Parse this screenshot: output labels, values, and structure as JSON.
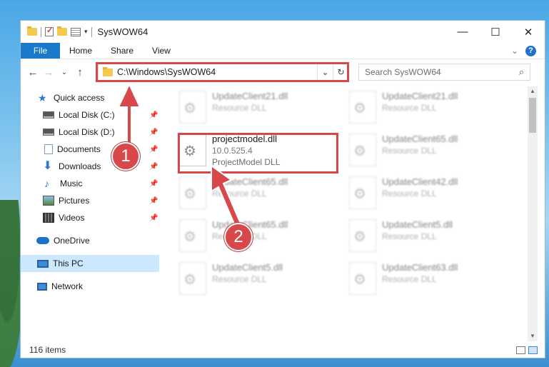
{
  "window": {
    "title": "SysWOW64",
    "quick_access_toolbar": [
      "folder-icon",
      "checkmark-icon",
      "new-folder-icon",
      "properties-icon"
    ],
    "controls": {
      "minimize": "—",
      "maximize": "☐",
      "close": "✕"
    }
  },
  "ribbon": {
    "tabs": [
      {
        "label": "File",
        "active": true
      },
      {
        "label": "Home"
      },
      {
        "label": "Share"
      },
      {
        "label": "View"
      }
    ],
    "collapse": "⌄",
    "help": "?"
  },
  "navigation": {
    "back": "←",
    "forward": "→",
    "recent": "⌄",
    "up": "↑"
  },
  "address": {
    "path": "C:\\Windows\\SysWOW64",
    "dropdown": "⌄",
    "refresh": "↻"
  },
  "search": {
    "placeholder": "Search SysWOW64",
    "icon": "search-icon"
  },
  "sidebar": {
    "items": [
      {
        "label": "Quick access",
        "icon": "star-icon"
      },
      {
        "label": "Local Disk (C:)",
        "icon": "disk-icon",
        "pinned": true
      },
      {
        "label": "Local Disk (D:)",
        "icon": "disk-icon",
        "pinned": true
      },
      {
        "label": "Documents",
        "icon": "documents-icon",
        "pinned": true
      },
      {
        "label": "Downloads",
        "icon": "download-icon",
        "pinned": true
      },
      {
        "label": "Music",
        "icon": "music-icon",
        "pinned": true
      },
      {
        "label": "Pictures",
        "icon": "pictures-icon",
        "pinned": true
      },
      {
        "label": "Videos",
        "icon": "videos-icon",
        "pinned": true
      },
      {
        "label": "OneDrive",
        "icon": "cloud-icon"
      },
      {
        "label": "This PC",
        "icon": "computer-icon",
        "selected": true
      },
      {
        "label": "Network",
        "icon": "network-icon"
      }
    ],
    "pin_glyph": "📌"
  },
  "files": [
    {
      "name": "UpdateClient21.dll",
      "desc": "Resource DLL",
      "blurred": true
    },
    {
      "name": "UpdateClient21.dll",
      "desc": "Resource DLL",
      "blurred": true
    },
    {
      "name": "projectmodel.dll",
      "version": "10.0.525.4",
      "desc": "ProjectModel DLL",
      "highlighted": true
    },
    {
      "name": "UpdateClient65.dll",
      "desc": "Resource DLL",
      "blurred": true
    },
    {
      "name": "UpdateClient65.dll",
      "desc": "Resource DLL",
      "blurred": true
    },
    {
      "name": "UpdateClient42.dll",
      "desc": "Resource DLL",
      "blurred": true
    },
    {
      "name": "UpdateClient65.dll",
      "desc": "Resource DLL",
      "blurred": true
    },
    {
      "name": "UpdateClient5.dll",
      "desc": "Resource DLL",
      "blurred": true
    },
    {
      "name": "UpdateClient5.dll",
      "desc": "Resource DLL",
      "blurred": true
    },
    {
      "name": "UpdateClient63.dll",
      "desc": "Resource DLL",
      "blurred": true
    }
  ],
  "status": {
    "item_count": "116 items"
  },
  "annotations": {
    "step1": "1",
    "step2": "2",
    "highlight_color": "#d8484a"
  }
}
